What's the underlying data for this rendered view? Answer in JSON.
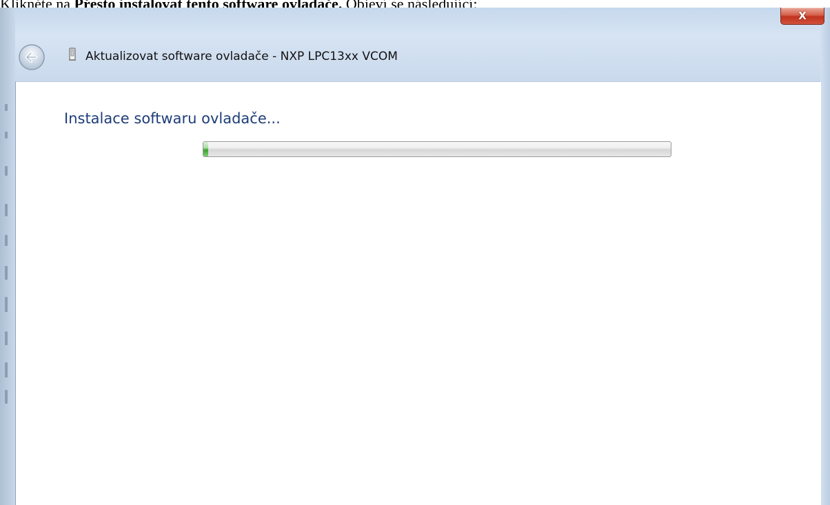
{
  "document": {
    "caption_start": "Klikněte na ",
    "caption_bold": "Přesto instalovat tento software ovladače.",
    "caption_end": " Objeví se následující:"
  },
  "window": {
    "title": "Aktualizovat software ovladače - NXP LPC13xx VCOM",
    "close_label": "X",
    "icons": {
      "back": "back-arrow-icon",
      "device": "usb-device-icon"
    }
  },
  "content": {
    "heading": "Instalace softwaru ovladače..."
  },
  "progress": {
    "value": 0.01
  },
  "colors": {
    "heading": "#1e3d78",
    "close_button": "#c1321d",
    "progress_fill": "#3aa02c",
    "frame": "#c6d8ec"
  }
}
